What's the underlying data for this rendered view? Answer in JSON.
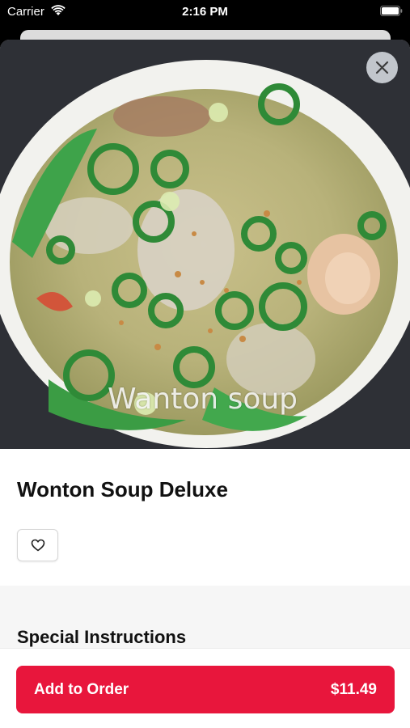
{
  "status_bar": {
    "carrier": "Carrier",
    "time": "2:16 PM"
  },
  "hero": {
    "caption": "Wanton soup"
  },
  "item": {
    "title": "Wonton Soup Deluxe"
  },
  "instructions": {
    "title": "Special Instructions"
  },
  "order_button": {
    "label": "Add to Order",
    "price": "$11.49"
  },
  "colors": {
    "accent": "#e8163c"
  }
}
